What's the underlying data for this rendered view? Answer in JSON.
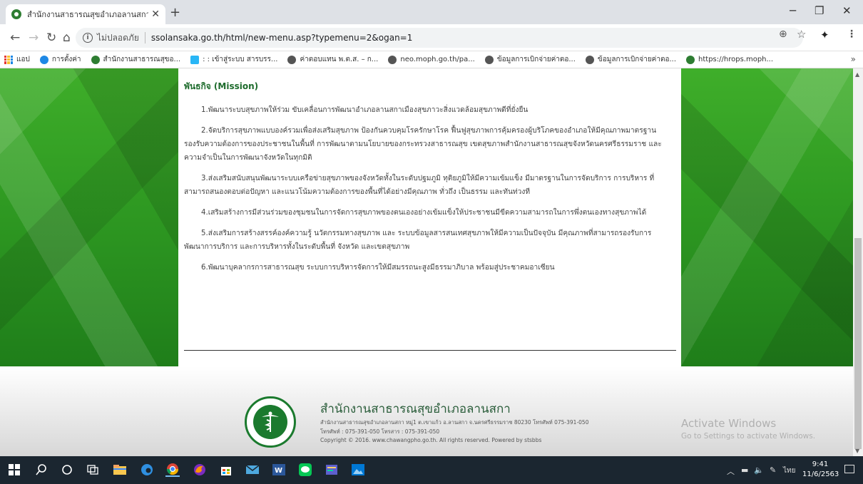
{
  "browser": {
    "tab_title": "สำนักงานสาธารณสุขอำเภอลานสกา หน้า",
    "tab_close": "✕",
    "new_tab": "+",
    "security_label": "ไม่ปลอดภัย",
    "url": "ssolansaka.go.th/html/new-menu.asp?typemenu=2&ogan=1",
    "bookmarks": [
      {
        "label": "แอป",
        "icon": "apps-icon"
      },
      {
        "label": "การตั้งค่า",
        "icon": "gear-icon",
        "color": "#1e88e5"
      },
      {
        "label": "สำนักงานสาธารณสุขอ...",
        "icon": "site-icon",
        "color": "#2e7d32"
      },
      {
        "label": ": : เข้าสู่ระบบ สารบรร...",
        "icon": "site-icon",
        "color": "#29b6f6"
      },
      {
        "label": "ค่าตอบแทน พ.ต.ส. – ก...",
        "icon": "globe-icon",
        "color": "#555555"
      },
      {
        "label": "neo.moph.go.th/pa...",
        "icon": "globe-icon",
        "color": "#555555"
      },
      {
        "label": "ข้อมูลการเบิกจ่ายค่าตอ...",
        "icon": "globe-icon",
        "color": "#555555"
      },
      {
        "label": "ข้อมูลการเบิกจ่ายค่าตอ...",
        "icon": "globe-icon",
        "color": "#555555"
      },
      {
        "label": "https://hrops.moph...",
        "icon": "site-icon",
        "color": "#2e7d32"
      }
    ],
    "bookmarks_more": "»"
  },
  "page": {
    "mission_title": "พันธกิจ (Mission)",
    "mission_items": [
      "1.พัฒนาระบบสุขภาพให้ร่วม ขับเคลื่อนการพัฒนาอำเภอลานสกาเมืองสุขภาวะสิ่งแวดล้อมสุขภาพดีที่ยั่งยืน",
      "2.จัดบริการสุขภาพแบบองค์รวมเพื่อส่งเสริมสุขภาพ ป้องกันควบคุมโรครักษาโรค ฟื้นฟูสุขภาพการคุ้มครองผู้บริโภคของอำเภอให้มีคุณภาพมาตรฐาน รองรับความต้องการของประชาชนในพื้นที่ การพัฒนาตามนโยบายของกระทรวงสาธารณสุข เขตสุขภาพสำนักงานสาธารณสุขจังหวัดนครศรีธรรมราช และความจำเป็นในการพัฒนาจังหวัดในทุกมิติ",
      "3.ส่งเสริมสนับสนุนพัฒนาระบบเครือข่ายสุขภาพของจังหวัดทั้งในระดับปฐมภูมิ ทุติยภูมิให้มีความเข้มแข็ง มีมาตรฐานในการจัดบริการ การบริหาร ที่สามารถสนองตอบต่อปัญหา และแนวโน้มความต้องการของพื้นที่ได้อย่างมีคุณภาพ ทั่วถึง เป็นธรรม และทันท่วงที",
      "4.เสริมสร้างการมีส่วนร่วมของชุมชนในการจัดการสุขภาพของตนเองอย่างเข้มแข็งให้ประชาชนมีขีดความสามารถในการพึ่งตนเองทางสุขภาพได้",
      "5.ส่งเสริมการสร้างสรรค์องค์ความรู้ นวัตกรรมทางสุขภาพ และ ระบบข้อมูลสารสนเทศสุขภาพให้มีความเป็นปัจจุบัน มีคุณภาพที่สามารถรองรับการพัฒนาการบริการ และการบริหารทั้งในระดับพื้นที่ จังหวัด และเขตสุขภาพ",
      "6.พัฒนาบุคลากรการสาธารณสุข ระบบการบริหารจัดการให้มีสมรรถนะสูงมีธรรมาภิบาล พร้อมสู่ประชาคมอาเซียน"
    ]
  },
  "footer": {
    "org_name": "สำนักงานสาธารณสุขอำเภอลานสกา",
    "address": "สำนักงานสาธารณสุขอำเภอลานสกา หมู่1 ต.เขาแก้ว อ.ลานสกา จ.นครศรีธรรมราช 80230 โทรศัพท์ 075-391-050",
    "phone": "โทรศัพท์ : 075-391-050 โทรสาร : 075-391-050",
    "copyright": "Copyright © 2016. www.chawangpho.go.th. All rights reserved. Powered by stsbbs",
    "seal_text": "MINISTRY OF PUBLIC HEALTH"
  },
  "watermark": {
    "title": "Activate Windows",
    "subtitle": "Go to Settings to activate Windows."
  },
  "taskbar": {
    "tray_ime": "ไทย",
    "time": "9:41",
    "date": "11/6/2563"
  },
  "colors": {
    "accent_green": "#2f9a22",
    "title_green": "#1d6b2c",
    "taskbar_bg": "#1b2630"
  }
}
